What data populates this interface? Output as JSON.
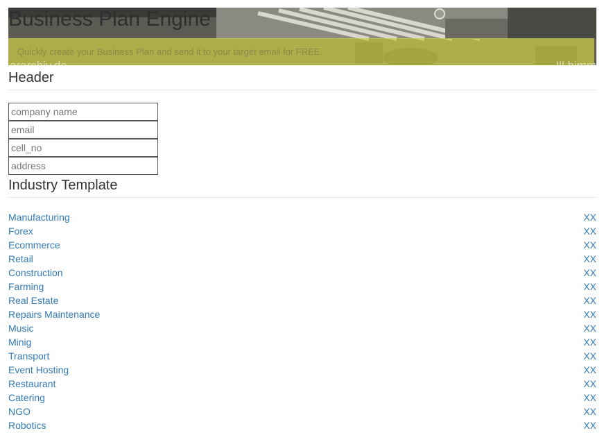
{
  "banner": {
    "title": "Business Plan Engine",
    "subtitle": "Quickly create your Business Plan and send it to your target email for FREE.",
    "watermark_left": "ararchiv.de",
    "watermark_right": "Ill bimm"
  },
  "sections": {
    "header_title": "Header",
    "industry_title": "Industry Template"
  },
  "form": {
    "company_placeholder": "company name",
    "email_placeholder": "email",
    "cell_placeholder": "cell_no",
    "address_placeholder": "address"
  },
  "industries": [
    {
      "label": "Manufacturing",
      "action": "XX"
    },
    {
      "label": "Forex",
      "action": "XX"
    },
    {
      "label": "Ecommerce",
      "action": "XX"
    },
    {
      "label": "Retail",
      "action": "XX"
    },
    {
      "label": "Construction",
      "action": "XX"
    },
    {
      "label": "Farming",
      "action": "XX"
    },
    {
      "label": "Real Estate",
      "action": "XX"
    },
    {
      "label": "Repairs Maintenance",
      "action": "XX"
    },
    {
      "label": "Music",
      "action": "XX"
    },
    {
      "label": "Minig",
      "action": "XX"
    },
    {
      "label": "Transport",
      "action": "XX"
    },
    {
      "label": "Event Hosting",
      "action": "XX"
    },
    {
      "label": "Restaurant",
      "action": "XX"
    },
    {
      "label": "Catering",
      "action": "XX"
    },
    {
      "label": "NGO",
      "action": "XX"
    },
    {
      "label": "Robotics",
      "action": "XX"
    }
  ],
  "colors": {
    "link": "#337ab7",
    "banner_band": "#cdce46",
    "text": "#333333"
  }
}
